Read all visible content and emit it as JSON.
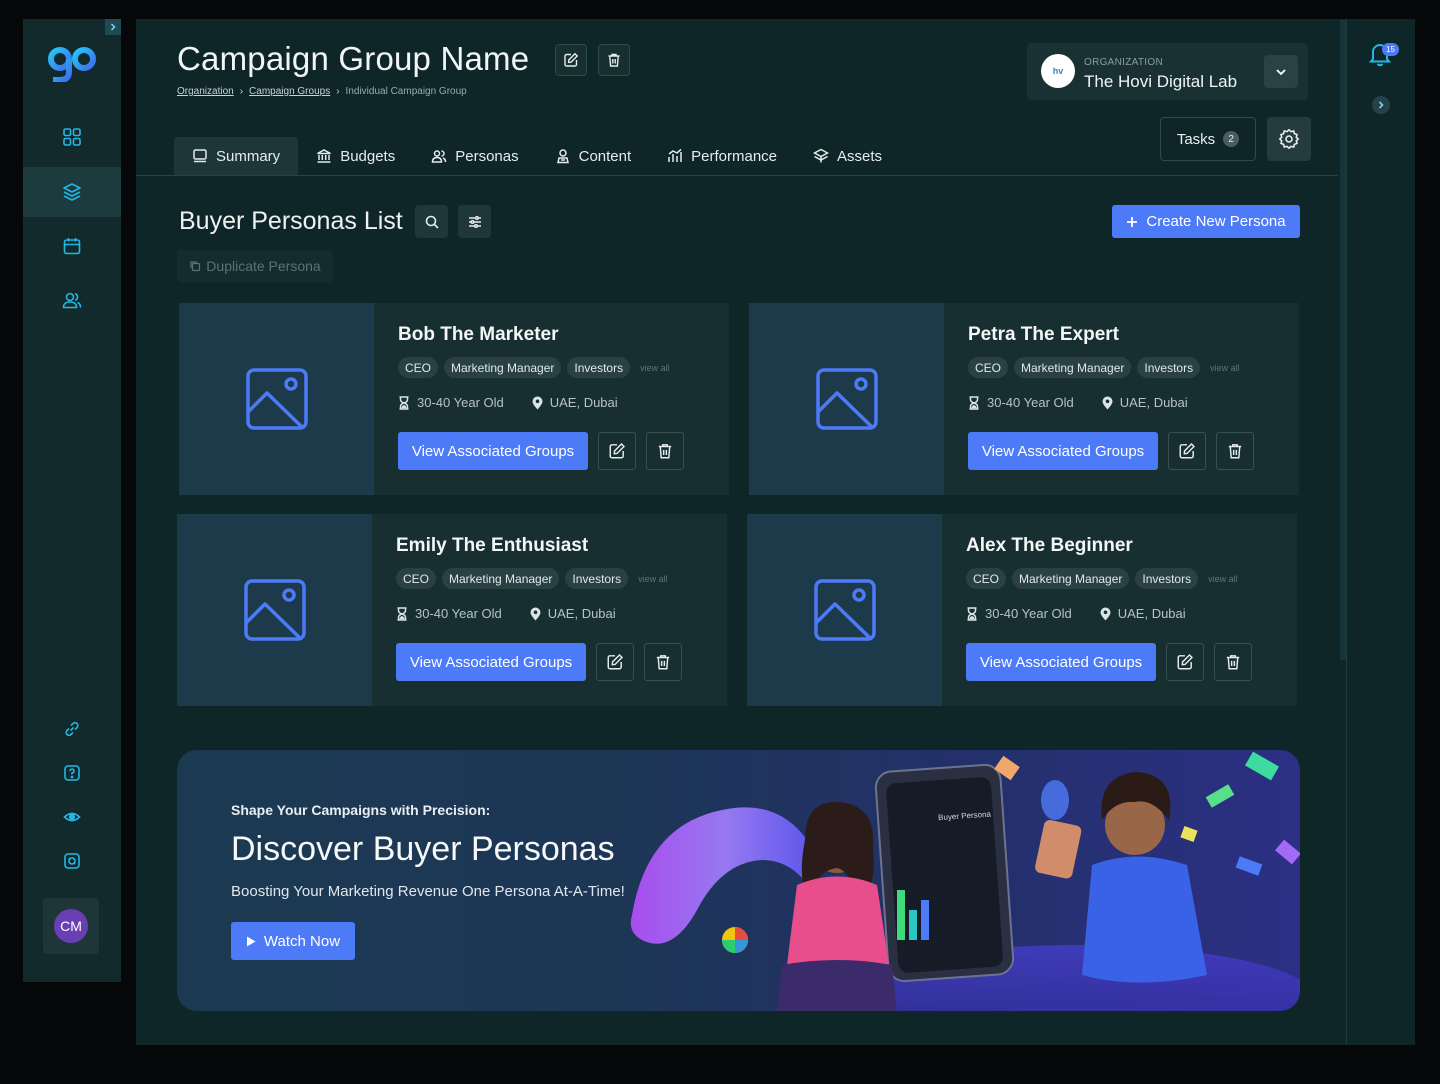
{
  "sidebar": {
    "nav": [
      "dashboard-icon",
      "layers-icon",
      "calendar-icon",
      "users-icon"
    ],
    "bottom": [
      "link-icon",
      "help-icon",
      "eye-icon",
      "brain-icon"
    ],
    "avatar_initials": "CM"
  },
  "header": {
    "title": "Campaign Group Name",
    "breadcrumbs": [
      "Organization",
      "Campaign Groups",
      "Individual Campaign Group"
    ],
    "org_label": "ORGANIZATION",
    "org_name": "The Hovi Digital Lab",
    "org_logo_text": "hv",
    "tasks_label": "Tasks",
    "tasks_count": "2",
    "notifications_count": "15"
  },
  "tabs": [
    {
      "label": "Summary",
      "icon": "summary-icon"
    },
    {
      "label": "Budgets",
      "icon": "bank-icon"
    },
    {
      "label": "Personas",
      "icon": "personas-icon"
    },
    {
      "label": "Content",
      "icon": "content-icon"
    },
    {
      "label": "Performance",
      "icon": "performance-icon"
    },
    {
      "label": "Assets",
      "icon": "assets-icon"
    }
  ],
  "list": {
    "title": "Buyer Personas List",
    "create_label": "Create New Persona",
    "duplicate_label": "Duplicate Persona"
  },
  "personas": [
    {
      "name": "Bob The Marketer",
      "tags": [
        "CEO",
        "Marketing Manager",
        "Investors"
      ],
      "view_all": "view all",
      "age": "30-40 Year Old",
      "location": "UAE, Dubai",
      "action": "View Associated Groups"
    },
    {
      "name": "Petra The Expert",
      "tags": [
        "CEO",
        "Marketing Manager",
        "Investors"
      ],
      "view_all": "view all",
      "age": "30-40 Year Old",
      "location": "UAE, Dubai",
      "action": "View Associated Groups"
    },
    {
      "name": "Emily The Enthusiast",
      "tags": [
        "CEO",
        "Marketing Manager",
        "Investors"
      ],
      "view_all": "view all",
      "age": "30-40 Year Old",
      "location": "UAE, Dubai",
      "action": "View Associated Groups"
    },
    {
      "name": "Alex The Beginner",
      "tags": [
        "CEO",
        "Marketing Manager",
        "Investors"
      ],
      "view_all": "view all",
      "age": "30-40 Year Old",
      "location": "UAE, Dubai",
      "action": "View Associated Groups"
    }
  ],
  "banner": {
    "subtitle": "Shape Your Campaigns with Precision:",
    "title": "Discover Buyer Personas",
    "description": "Boosting Your Marketing Revenue One Persona At-A-Time!",
    "button": "Watch Now",
    "phone_text": "Buyer Persona"
  },
  "colors": {
    "accent": "#4d7af6",
    "icon_cyan": "#23b7e5",
    "panel": "#0f2628"
  }
}
